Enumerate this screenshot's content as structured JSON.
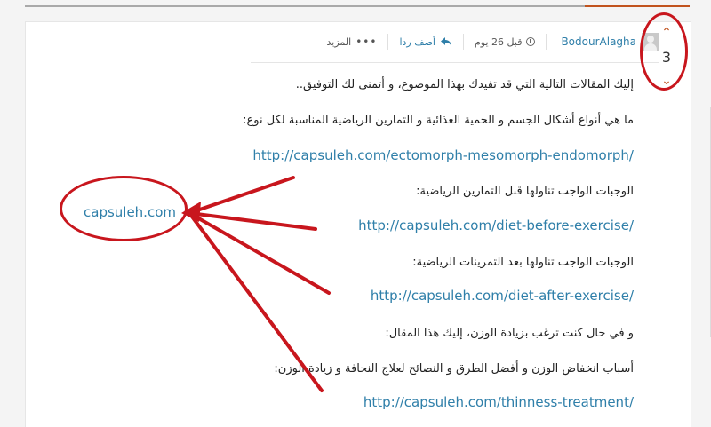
{
  "post": {
    "author": "BodourAlagha",
    "time": "قبل 26 يوم",
    "reply_label": "أضف ردا",
    "more_label": "المزيد",
    "vote_count": "3"
  },
  "content": {
    "intro": "إليك المقالات التالية التي قد تفيدك بهذا الموضوع، و أتمنى لك التوفيق..",
    "q1": "ما هي أنواع أشكال الجسم و الحمية الغذائية و التمارين الرياضية المناسبة لكل نوع:",
    "link1": "http://capsuleh.com/ectomorph-mesomorph-endomorph/",
    "q2": "الوجبات الواجب تناولها قبل التمارين الرياضية:",
    "link2": "http://capsuleh.com/diet-before-exercise/",
    "q3": "الوجبات الواجب تناولها بعد التمرينات الرياضية:",
    "link3": "http://capsuleh.com/diet-after-exercise/",
    "q4": "و في حال كنت ترغب بزيادة الوزن، إليك هذا المقال:",
    "q5": "أسباب انخفاض الوزن و أفضل الطرق و النصائح لعلاج النحافة و زيادة الوزن:",
    "link4": "http://capsuleh.com/thinness-treatment/"
  },
  "annotation": {
    "label": "capsuleh.com",
    "color": "#c8161d"
  },
  "colors": {
    "link": "#2f7fa9",
    "accent": "#c1531e"
  }
}
